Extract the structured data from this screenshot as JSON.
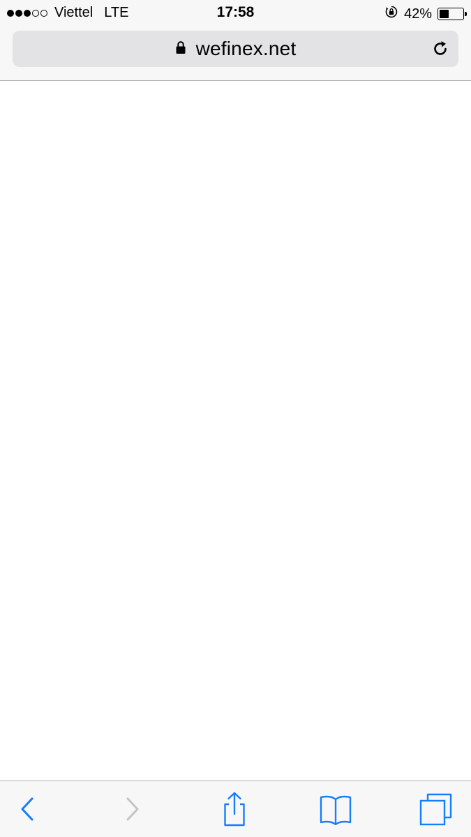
{
  "status_bar": {
    "carrier": "Viettel",
    "network": "LTE",
    "time": "17:58",
    "battery_percent": "42%",
    "battery_level": 0.42,
    "signal_bars_filled": 3,
    "signal_bars_total": 5
  },
  "address_bar": {
    "url": "wefinex.net",
    "secure_icon": "lock-icon",
    "reload_icon": "reload-icon"
  },
  "toolbar": {
    "buttons": [
      {
        "name": "back",
        "icon": "chevron-left-icon",
        "enabled": true
      },
      {
        "name": "forward",
        "icon": "chevron-right-icon",
        "enabled": false
      },
      {
        "name": "share",
        "icon": "share-icon",
        "enabled": true
      },
      {
        "name": "bookmarks",
        "icon": "book-icon",
        "enabled": true
      },
      {
        "name": "tabs",
        "icon": "tabs-icon",
        "enabled": true
      }
    ]
  },
  "colors": {
    "accent": "#157efb",
    "disabled": "#c4c4c7",
    "chrome_bg": "#f7f7f7",
    "address_bg": "#e3e3e6"
  }
}
